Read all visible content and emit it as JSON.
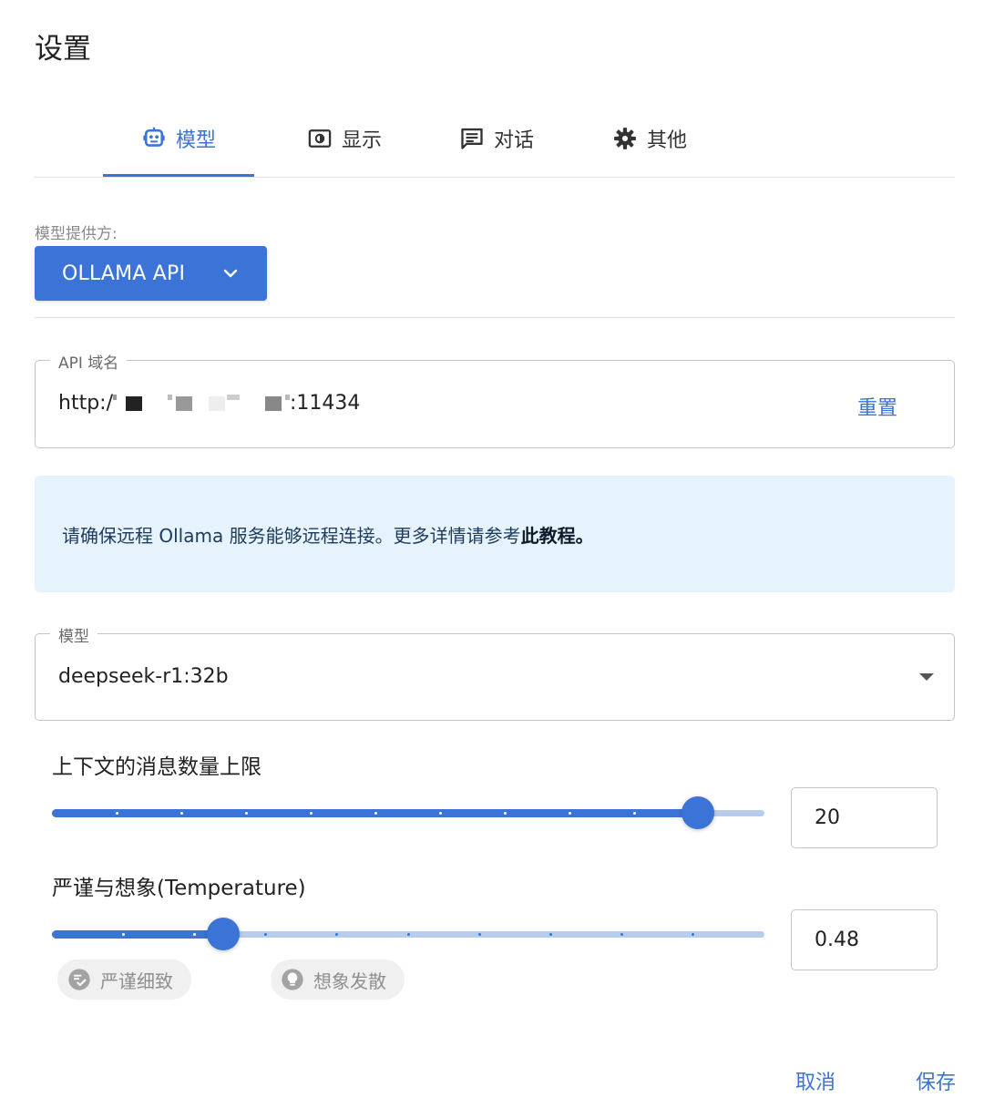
{
  "dialog": {
    "title": "设置"
  },
  "tabs": [
    {
      "label": "模型",
      "icon": "robot-icon",
      "active": true
    },
    {
      "label": "显示",
      "icon": "display-icon",
      "active": false
    },
    {
      "label": "对话",
      "icon": "chat-icon",
      "active": false
    },
    {
      "label": "其他",
      "icon": "gear-icon",
      "active": false
    }
  ],
  "provider": {
    "label": "模型提供方:",
    "value": "OLLAMA API"
  },
  "api_host": {
    "legend": "API 域名",
    "value_prefix": "http:/",
    "value_suffix": ":11434",
    "reset_label": "重置"
  },
  "alert": {
    "text": "请确保远程 Ollama 服务能够远程连接。更多详情请参考",
    "link": "此教程",
    "end": "。"
  },
  "model": {
    "legend": "模型",
    "value": "deepseek-r1:32b"
  },
  "context_limit": {
    "label": "上下文的消息数量上限",
    "value": "20",
    "fraction": 0.907
  },
  "temperature": {
    "label": "严谨与想象(Temperature)",
    "value": "0.48",
    "fraction": 0.24,
    "chip_left": "严谨细致",
    "chip_right": "想象发散"
  },
  "actions": {
    "cancel": "取消",
    "save": "保存"
  },
  "colors": {
    "accent": "#3c73d6",
    "alert_bg": "#e6f3fc",
    "rail": "#b7cdee"
  }
}
